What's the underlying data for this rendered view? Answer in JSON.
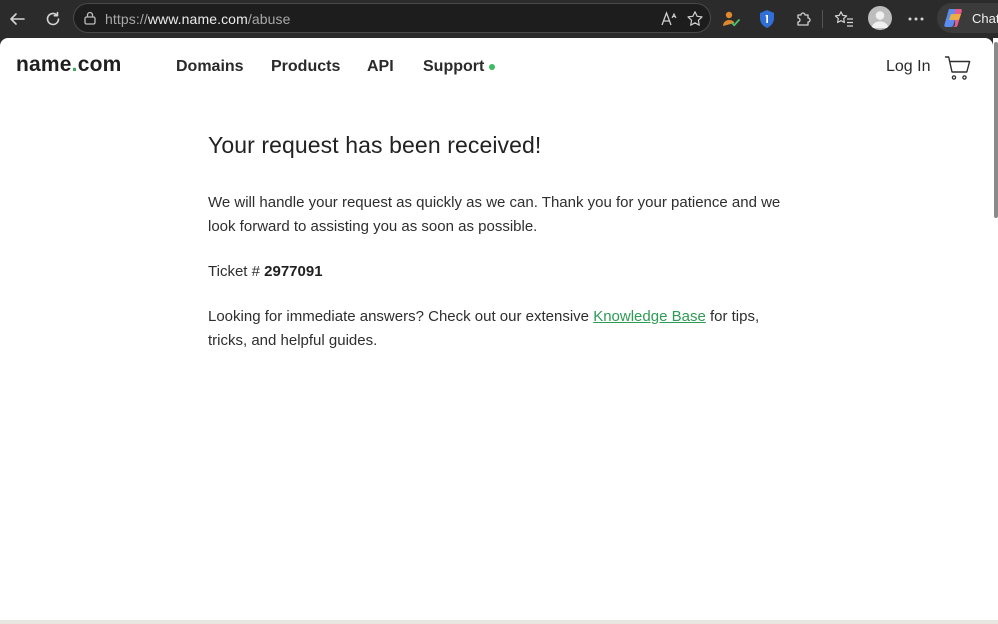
{
  "browser": {
    "url_prefix": "https://",
    "url_host": "www.name.com",
    "url_path": "/abuse",
    "read_aloud_label": "Aᴬ",
    "chat_label": "Chat"
  },
  "site": {
    "logo_text_1": "name",
    "logo_dot": ".",
    "logo_text_2": "com",
    "nav": {
      "domains": "Domains",
      "products": "Products",
      "api": "API",
      "support": "Support"
    },
    "login": "Log In",
    "accent_color": "#3ca85f"
  },
  "main": {
    "heading": "Your request has been received!",
    "paragraph1": "We will handle your request as quickly as we can. Thank you for your patience and we look forward to assisting you as soon as possible.",
    "ticket_label": "Ticket # ",
    "ticket_number": "2977091",
    "paragraph2_before": "Looking for immediate answers? Check out our extensive ",
    "kb_link": "Knowledge Base",
    "paragraph2_after": " for tips, tricks, and helpful guides."
  }
}
